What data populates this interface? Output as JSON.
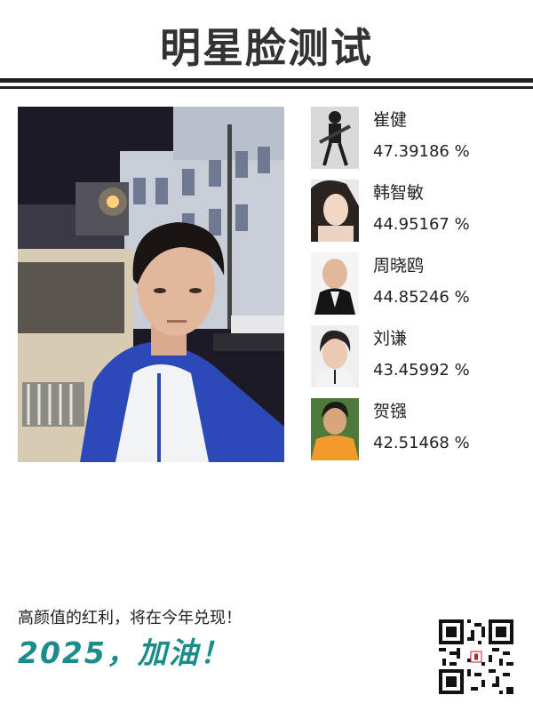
{
  "header": {
    "title": "明星脸测试"
  },
  "matches": [
    {
      "name": "崔健",
      "score": "47.39186 %"
    },
    {
      "name": "韩智敏",
      "score": "44.95167 %"
    },
    {
      "name": "周晓鸥",
      "score": "44.85246 %"
    },
    {
      "name": "刘谦",
      "score": "43.45992 %"
    },
    {
      "name": "贺镪",
      "score": "42.51468 %"
    }
  ],
  "footer": {
    "tagline": "高颜值的红利，将在今年兑现！",
    "slogan": "2025，加油！"
  },
  "colors": {
    "accent": "#1a8c89",
    "rule": "#222222"
  }
}
